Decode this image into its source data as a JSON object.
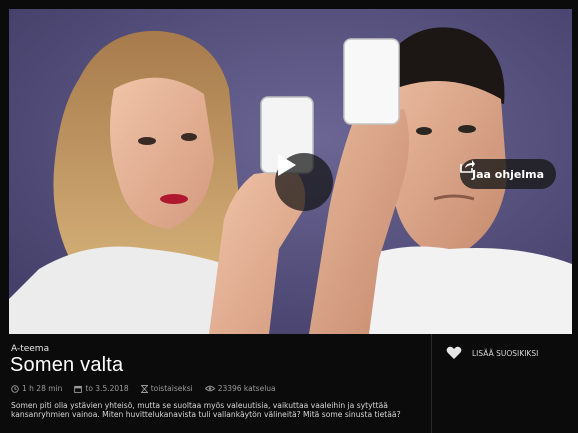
{
  "share": {
    "label": "Jaa ohjelma"
  },
  "program": {
    "channel": "A-teema",
    "title": "Somen valta",
    "duration": "1 h 28 min",
    "date": "to 3.5.2018",
    "availability": "toistaiseksi",
    "views": "23396 katselua",
    "description": "Somen piti olla ystävien yhteisö, mutta se suoltaa myös valeuutisia, vaikuttaa vaaleihin ja sytyttää kansanryhmien vainoa. Miten huvittelukanavista tuli vallankäytön välineitä? Mitä some sinusta tietää?"
  },
  "favorite": {
    "label": "LISÄÄ SUOSIKIKSI"
  },
  "icons": {
    "play": "play-icon",
    "share": "share-icon",
    "clock": "clock-icon",
    "calendar": "calendar-icon",
    "hourglass": "hourglass-icon",
    "eye": "eye-icon",
    "heart": "heart-icon"
  },
  "colors": {
    "background": "#0b0b0b",
    "hero_bg": "#5b5680",
    "text": "#ffffff",
    "muted": "#9b9b9b"
  }
}
